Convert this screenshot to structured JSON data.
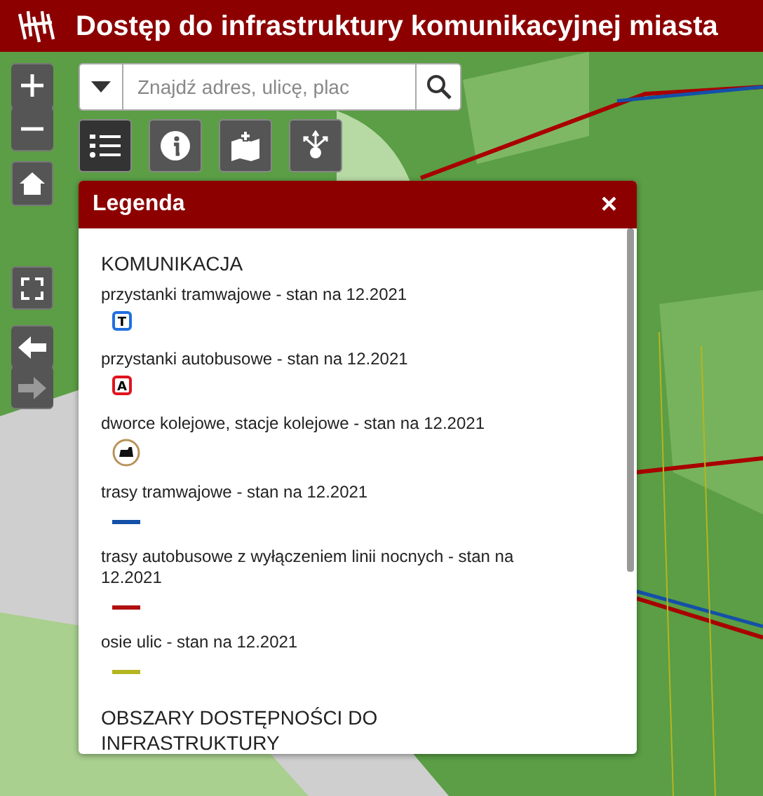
{
  "header": {
    "title": "Dostęp do infrastruktury komunikacyjnej miasta"
  },
  "search": {
    "placeholder": "Znajdź adres, ulicę, plac"
  },
  "toolbar": [
    {
      "kind": "legend",
      "selected": true
    },
    {
      "kind": "info",
      "selected": false
    },
    {
      "kind": "add_layer",
      "selected": false
    },
    {
      "kind": "share",
      "selected": false
    }
  ],
  "navigation": [
    {
      "kind": "back",
      "disabled": false
    },
    {
      "kind": "forward",
      "disabled": true
    }
  ],
  "legend": {
    "title": "Legenda",
    "close": "×",
    "sections": [
      {
        "heading": "KOMUNIKACJA",
        "items": [
          {
            "label": "przystanki tramwajowe - stan na 12.2021",
            "kind": "stop",
            "symbol": "T",
            "color": "#1f6fe0"
          },
          {
            "label": "przystanki autobusowe - stan na 12.2021",
            "kind": "stop",
            "symbol": "A",
            "color": "#e0141e"
          },
          {
            "label": "dworce kolejowe, stacje kolejowe - stan na 12.2021",
            "kind": "station",
            "color": "#b8925a"
          },
          {
            "label": "trasy tramwajowe - stan na 12.2021",
            "kind": "line",
            "color": "#1450a8"
          },
          {
            "label": "trasy autobusowe z wyłączeniem linii nocnych - stan na 12.2021",
            "kind": "line",
            "color": "#b01010"
          },
          {
            "label": "osie ulic - stan na 12.2021",
            "kind": "line",
            "color": "#b5b520"
          }
        ]
      },
      {
        "heading": "OBSZARY DOSTĘPNOŚCI DO INFRASTRUKTURY"
      }
    ]
  }
}
